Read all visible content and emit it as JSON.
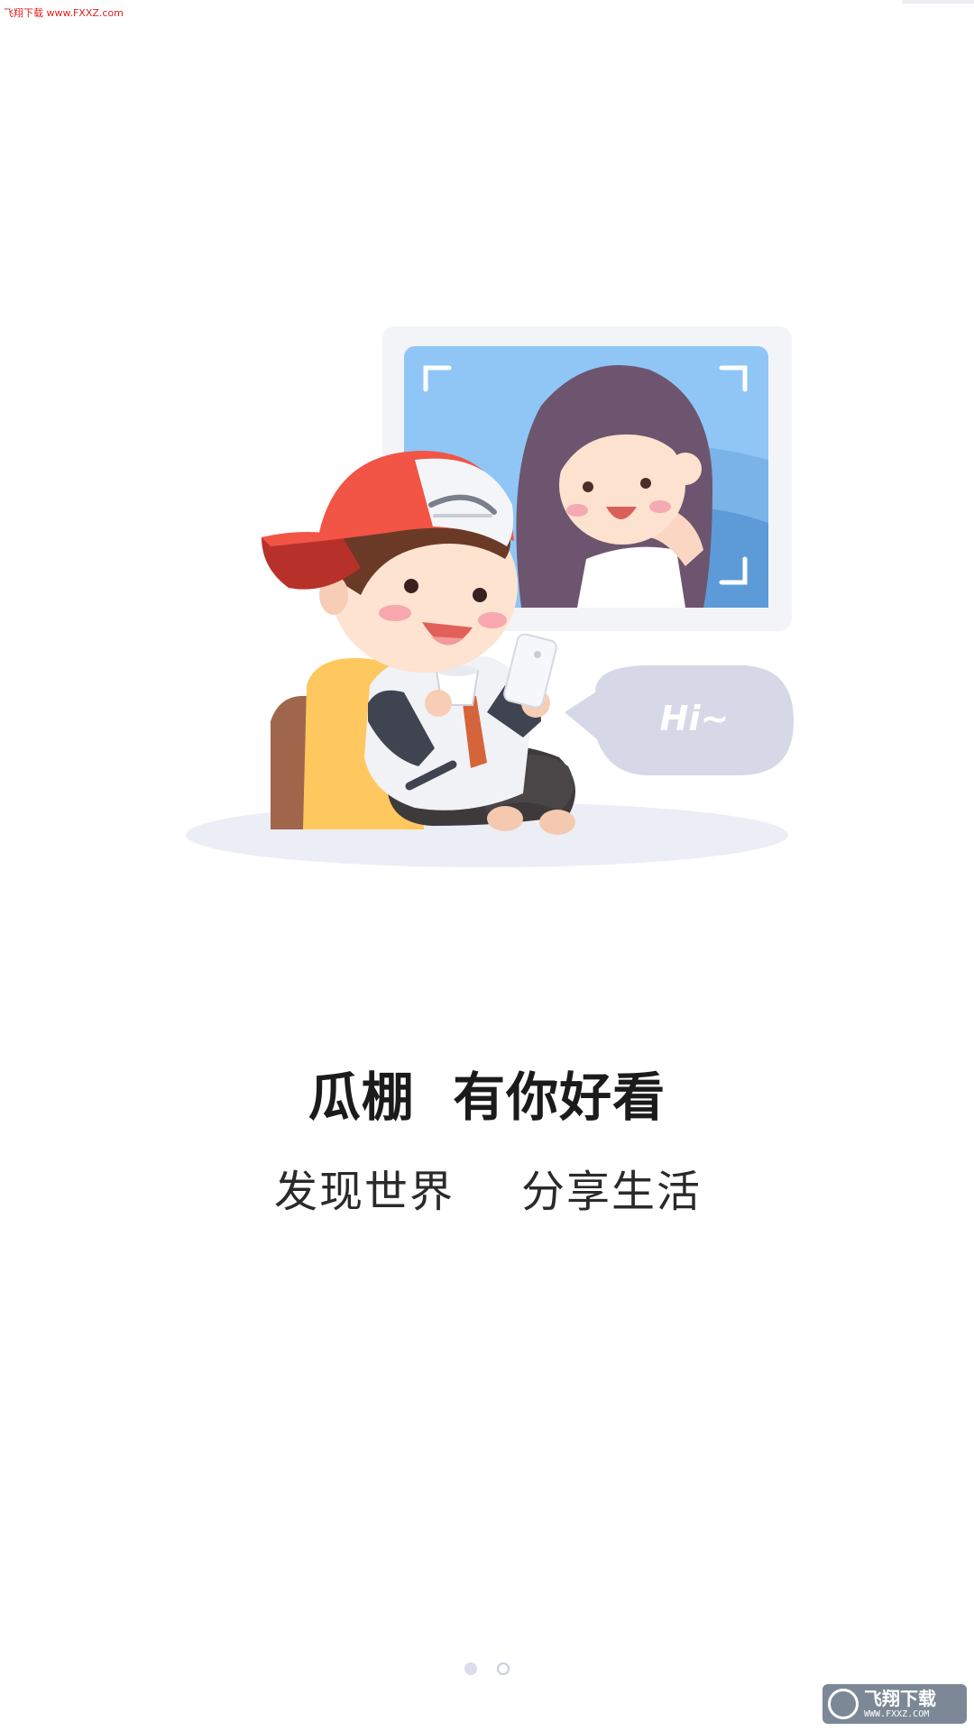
{
  "watermark": {
    "top_left": "飞翔下载 www.FXXZ.com",
    "badge_cn": "飞翔下载",
    "badge_url": "WWW.FXXZ.COM"
  },
  "illustration": {
    "speech_bubble": "Hi~"
  },
  "slogan": {
    "title": "瓜棚  有你好看",
    "subtitle_left": "发现世界",
    "subtitle_right": "分享生活"
  },
  "pager": {
    "count": 2,
    "active_index": 0
  },
  "colors": {
    "title": "#1b1b1b",
    "subtitle": "#2a2a2a",
    "dot_active": "#d9dced",
    "dot_inactive_border": "#c9cde0",
    "screen_blue": "#8fc6f5",
    "bubble": "#d6d8e8",
    "cap_red": "#f25445",
    "cushion_yellow": "#ffc85e"
  }
}
